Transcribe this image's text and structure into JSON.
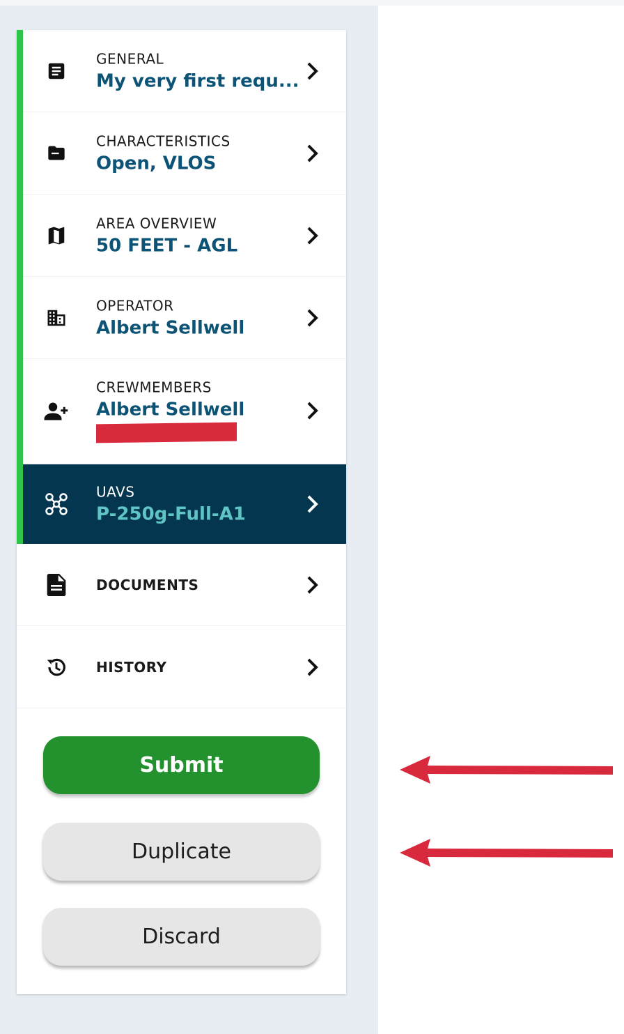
{
  "nav": {
    "items": [
      {
        "label": "GENERAL",
        "value": "My very first requ...",
        "icon": "document-icon"
      },
      {
        "label": "CHARACTERISTICS",
        "value": "Open, VLOS",
        "icon": "folder-icon"
      },
      {
        "label": "AREA OVERVIEW",
        "value": "50 FEET - AGL",
        "icon": "map-icon"
      },
      {
        "label": "OPERATOR",
        "value": "Albert Sellwell",
        "icon": "building-icon"
      },
      {
        "label": "CREWMEMBERS",
        "value": "Albert Sellwell",
        "icon": "add-person-icon"
      },
      {
        "label": "UAVS",
        "value": "P-250g-Full-A1",
        "icon": "drone-icon",
        "active": true
      },
      {
        "label": "DOCUMENTS",
        "icon": "file-icon"
      },
      {
        "label": "HISTORY",
        "icon": "history-icon"
      }
    ]
  },
  "actions": {
    "submit_label": "Submit",
    "duplicate_label": "Duplicate",
    "discard_label": "Discard"
  },
  "colors": {
    "completed_bar": "#2ec447",
    "active_bg": "#04364f",
    "active_value": "#5ec4c4",
    "value_text": "#0c5376",
    "submit_bg": "#22912e",
    "annotation_red": "#d92a3d"
  }
}
